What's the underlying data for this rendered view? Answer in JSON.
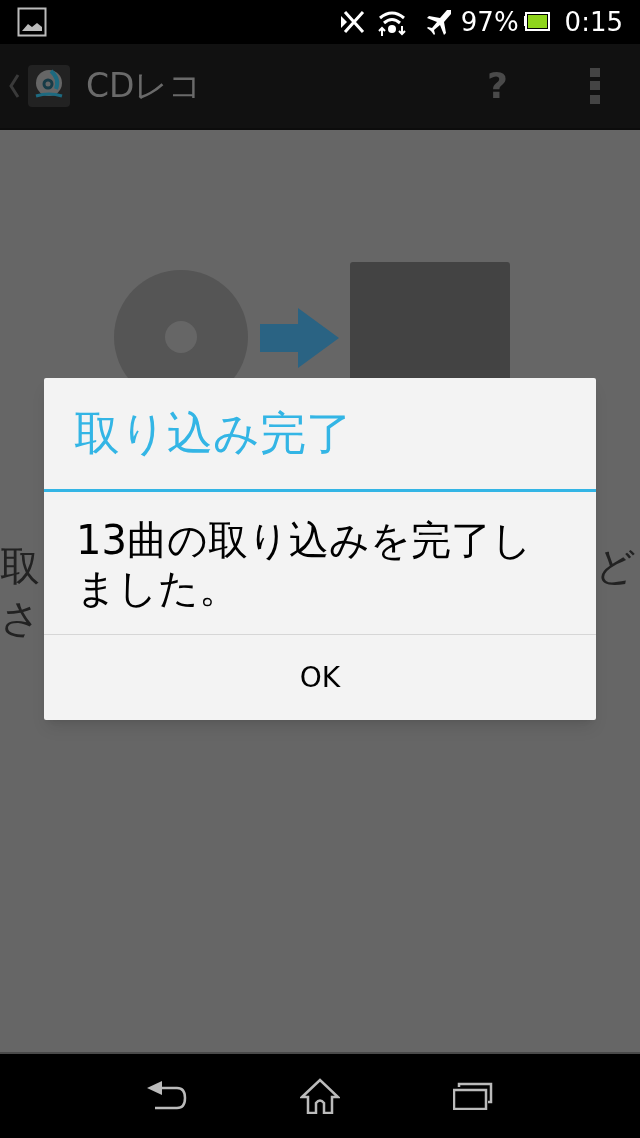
{
  "status_bar": {
    "battery": "97%",
    "time": "0:15"
  },
  "app_bar": {
    "title": "CDレコ",
    "help": "?"
  },
  "background": {
    "left_lines": [
      "取",
      "さ"
    ],
    "right_lines": [
      "ど"
    ]
  },
  "dialog": {
    "title": "取り込み完了",
    "message": "13曲の取り込みを完了しました。",
    "buttons": [
      "OK"
    ]
  }
}
